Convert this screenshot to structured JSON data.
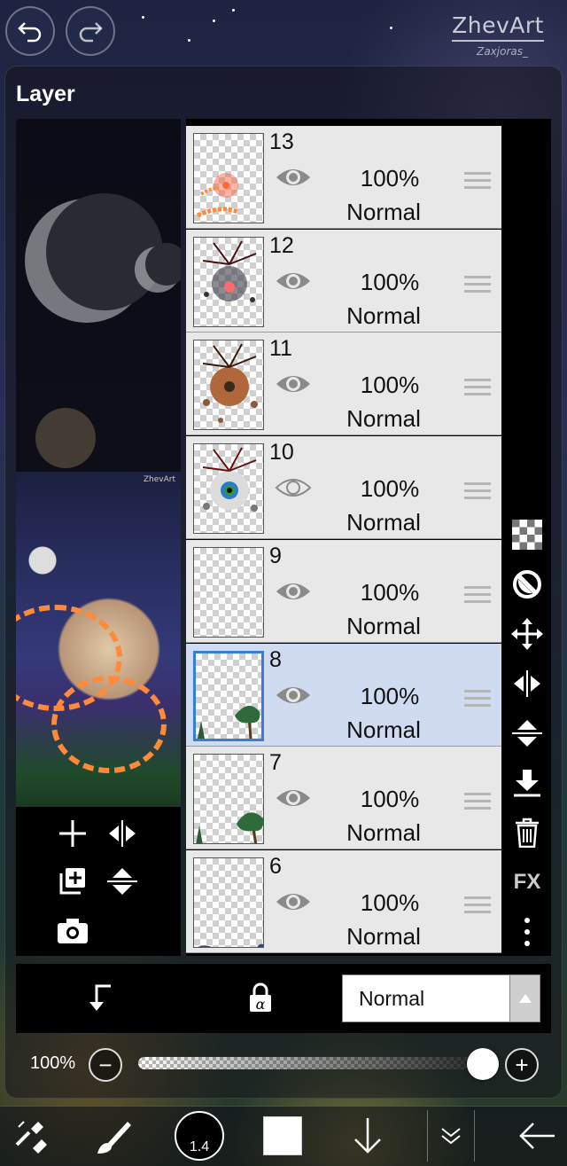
{
  "app": {
    "watermark_name": "ZhevArt",
    "watermark_signature": "Zaxjoras_"
  },
  "panel": {
    "title": "Layer"
  },
  "preview": {
    "watermark": "ZhevArt"
  },
  "layers": [
    {
      "number": "13",
      "opacity": "100%",
      "blend": "Normal",
      "visible": true,
      "selected": false
    },
    {
      "number": "12",
      "opacity": "100%",
      "blend": "Normal",
      "visible": true,
      "selected": false
    },
    {
      "number": "11",
      "opacity": "100%",
      "blend": "Normal",
      "visible": true,
      "selected": false
    },
    {
      "number": "10",
      "opacity": "100%",
      "blend": "Normal",
      "visible": false,
      "selected": false
    },
    {
      "number": "9",
      "opacity": "100%",
      "blend": "Normal",
      "visible": true,
      "selected": false
    },
    {
      "number": "8",
      "opacity": "100%",
      "blend": "Normal",
      "visible": true,
      "selected": true
    },
    {
      "number": "7",
      "opacity": "100%",
      "blend": "Normal",
      "visible": true,
      "selected": false
    },
    {
      "number": "6",
      "opacity": "100%",
      "blend": "Normal",
      "visible": true,
      "selected": false
    }
  ],
  "side_tools": {
    "fx_label": "FX"
  },
  "blend_mode": {
    "selected": "Normal"
  },
  "opacity": {
    "label": "100%",
    "value": 1.0,
    "minus": "−",
    "plus": "+"
  },
  "toolbar": {
    "brush_size": "1.4"
  },
  "colors": {
    "selected_row": "#cfdbf0",
    "row": "#e8e8e8",
    "selection_border": "#3a7bd5",
    "primary_color": "#ffffff"
  }
}
